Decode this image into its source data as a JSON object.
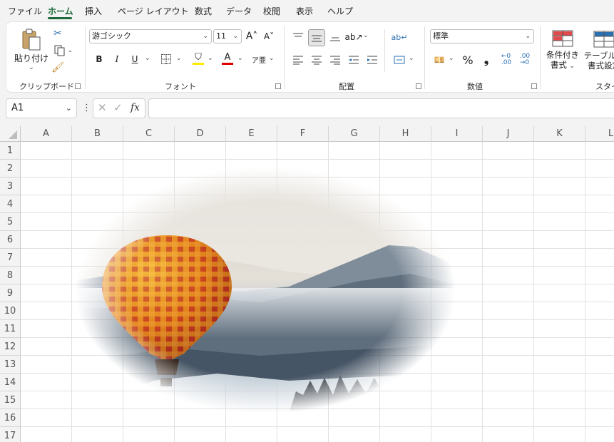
{
  "menu": [
    "ファイル",
    "ホーム",
    "挿入",
    "ページ レイアウト",
    "数式",
    "データ",
    "校閲",
    "表示",
    "ヘルプ"
  ],
  "ribbon": {
    "clipboard": {
      "paste": "貼り付け",
      "label": "クリップボード"
    },
    "font": {
      "name": "游ゴシック",
      "size": "11",
      "bold": "B",
      "italic": "I",
      "underline": "U",
      "label": "フォント"
    },
    "alignment": {
      "label": "配置"
    },
    "number": {
      "format": "標準",
      "percent": "%",
      "comma": "❟",
      "label": "数値"
    },
    "styles": {
      "conditional_line1": "条件付き",
      "conditional_line2": "書式",
      "table_line1": "テーブルと",
      "table_line2": "書式設定",
      "label": "スタイル"
    }
  },
  "formula_bar": {
    "name_box": "A1",
    "fx": "fx",
    "content": ""
  },
  "columns": [
    "A",
    "B",
    "C",
    "D",
    "E",
    "F",
    "G",
    "H",
    "I",
    "J",
    "K",
    "L"
  ],
  "rows": [
    "1",
    "2",
    "3",
    "4",
    "5",
    "6",
    "7",
    "8",
    "9",
    "10",
    "11",
    "12",
    "13",
    "14",
    "15",
    "16",
    "17"
  ],
  "picture": {
    "description_icon": "hot-air-balloon-photo"
  },
  "colors": {
    "accent": "#1e6a3a",
    "grid_line": "#e1e1e1",
    "header_bg": "#f3f3f3"
  }
}
